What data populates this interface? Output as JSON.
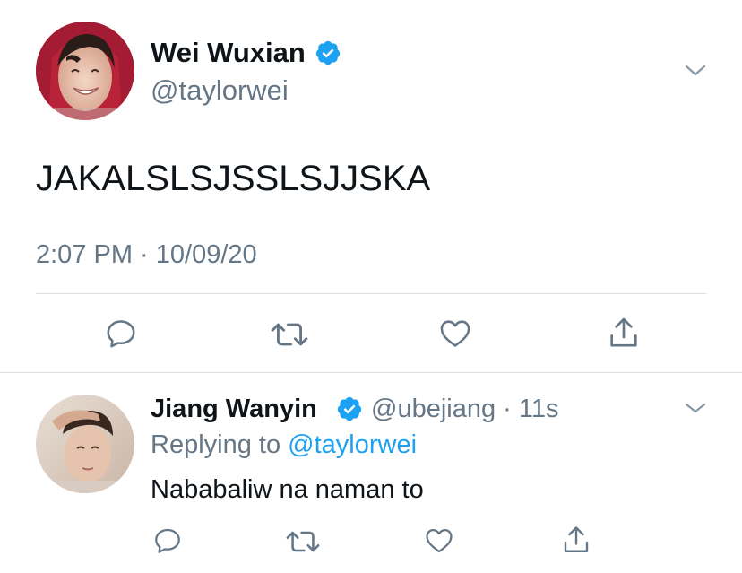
{
  "main_tweet": {
    "display_name": "Wei Wuxian",
    "handle": "@taylorwei",
    "text": "JAKALSLSJSSLSJJSKA",
    "timestamp": "2:07 PM · 10/09/20"
  },
  "reply_tweet": {
    "display_name": "Jiang Wanyin",
    "handle_time": "@ubejiang · 11s",
    "replying_to_label": "Replying to",
    "replying_to_handle": "@taylorwei",
    "text": "Nababaliw na naman to"
  },
  "icons": {
    "verified": "verified-badge-icon",
    "caret": "chevron-down-icon",
    "reply": "reply-icon",
    "retweet": "retweet-icon",
    "like": "heart-icon",
    "share": "share-icon"
  },
  "colors": {
    "accent": "#1da1f2",
    "secondary_text": "#657786",
    "primary_text": "#0f1419",
    "divider": "#d9dfe4"
  }
}
